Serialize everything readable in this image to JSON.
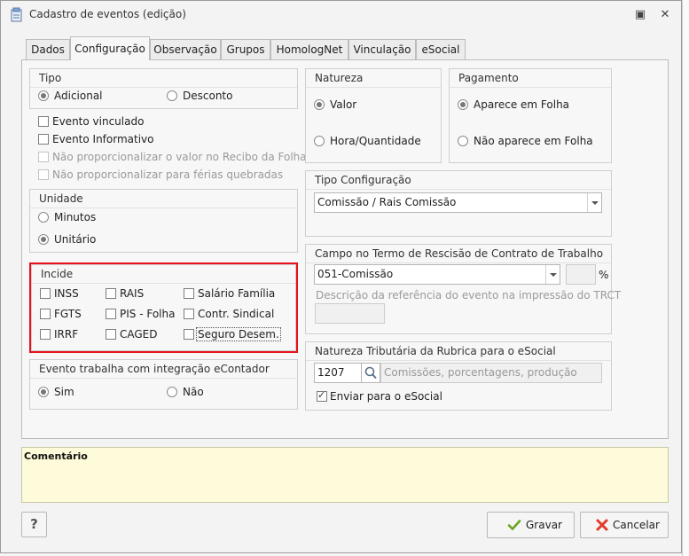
{
  "window": {
    "title": "Cadastro de eventos (edição)",
    "maximize_glyph": "▣",
    "close_glyph": "✕"
  },
  "tabs": [
    {
      "label": "Dados"
    },
    {
      "label": "Configuração",
      "active": true
    },
    {
      "label": "Observação"
    },
    {
      "label": "Grupos"
    },
    {
      "label": "HomologNet"
    },
    {
      "label": "Vinculação"
    },
    {
      "label": "eSocial"
    }
  ],
  "tipo": {
    "title": "Tipo",
    "adicional": "Adicional",
    "desconto": "Desconto",
    "selected": "Adicional"
  },
  "options": {
    "evento_vinculado": "Evento vinculado",
    "evento_informativo": "Evento Informativo",
    "nao_proporcionalizar_recibo": "Não proporcionalizar o valor no Recibo da Folha",
    "nao_proporcionalizar_ferias": "Não proporcionalizar para férias quebradas"
  },
  "unidade": {
    "title": "Unidade",
    "minutos": "Minutos",
    "unitario": "Unitário",
    "selected": "Unitário"
  },
  "incide": {
    "title": "Incide",
    "items": [
      "INSS",
      "RAIS",
      "Salário Família",
      "FGTS",
      "PIS - Folha",
      "Contr. Sindical",
      "IRRF",
      "CAGED",
      "Seguro Desem."
    ]
  },
  "econtador": {
    "title": "Evento trabalha com integração eContador",
    "sim": "Sim",
    "nao": "Não",
    "selected": "Sim"
  },
  "natureza": {
    "title": "Natureza",
    "valor": "Valor",
    "hora": "Hora/Quantidade",
    "selected": "Valor"
  },
  "pagamento": {
    "title": "Pagamento",
    "aparece": "Aparece em Folha",
    "nao_aparece": "Não aparece em Folha",
    "selected": "Aparece em Folha"
  },
  "tipo_config": {
    "title": "Tipo Configuração",
    "value": "Comissão / Rais Comissão"
  },
  "trct": {
    "title": "Campo no Termo de Rescisão de Contrato de Trabalho",
    "value": "051-Comissão",
    "percent_symbol": "%",
    "desc_label": "Descrição da referência do evento na impressão do TRCT"
  },
  "natureza_tributaria": {
    "title": "Natureza Tributária da Rubrica para o eSocial",
    "code": "1207",
    "description_placeholder": "Comissões, porcentagens, produção",
    "enviar": "Enviar para o eSocial",
    "enviar_checked": true
  },
  "comment": {
    "label": "Comentário"
  },
  "buttons": {
    "help": "?",
    "gravar": "Gravar",
    "cancelar": "Cancelar"
  },
  "colors": {
    "highlight": "#e8111a",
    "comment_bg": "#fdfbd9"
  }
}
